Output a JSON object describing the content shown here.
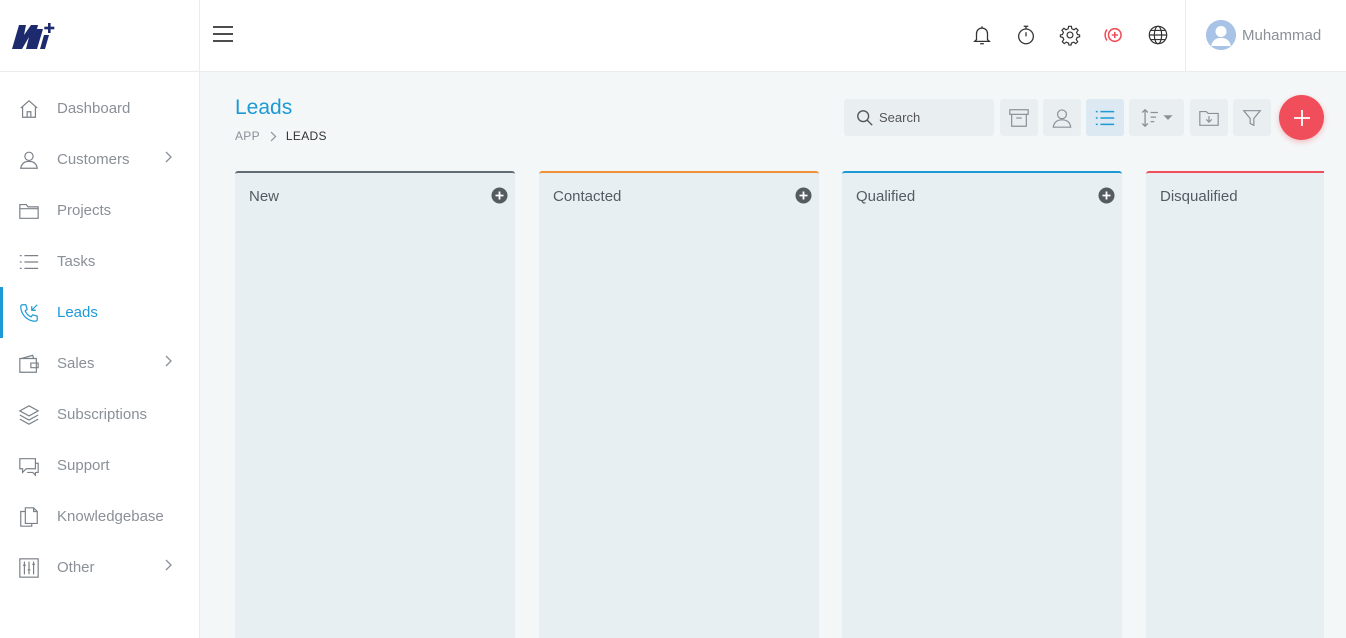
{
  "brand": {
    "logo_icon": "m-plus-logo",
    "accent": "#1d9ad6",
    "danger": "#f04e5a"
  },
  "sidebar": {
    "items": [
      {
        "label": "Dashboard",
        "icon": "home-icon",
        "has_children": false,
        "active": false
      },
      {
        "label": "Customers",
        "icon": "user-icon",
        "has_children": true,
        "active": false
      },
      {
        "label": "Projects",
        "icon": "folder-icon",
        "has_children": false,
        "active": false
      },
      {
        "label": "Tasks",
        "icon": "list-icon",
        "has_children": false,
        "active": false
      },
      {
        "label": "Leads",
        "icon": "phone-incoming-icon",
        "has_children": false,
        "active": true
      },
      {
        "label": "Sales",
        "icon": "wallet-icon",
        "has_children": true,
        "active": false
      },
      {
        "label": "Subscriptions",
        "icon": "layers-icon",
        "has_children": false,
        "active": false
      },
      {
        "label": "Support",
        "icon": "chat-icon",
        "has_children": false,
        "active": false
      },
      {
        "label": "Knowledgebase",
        "icon": "documents-icon",
        "has_children": false,
        "active": false
      },
      {
        "label": "Other",
        "icon": "sliders-icon",
        "has_children": true,
        "active": false
      }
    ]
  },
  "topbar": {
    "icons": [
      "menu-icon",
      "bell-icon",
      "timer-icon",
      "gear-icon",
      "help-plus-icon",
      "globe-icon"
    ],
    "user": {
      "name": "Muhammad",
      "avatar": "avatar-icon"
    }
  },
  "page": {
    "title": "Leads",
    "breadcrumb": {
      "root": "APP",
      "current": "LEADS"
    }
  },
  "toolbar": {
    "search_placeholder": "Search",
    "buttons": [
      "archive-icon",
      "user-icon",
      "list-view-icon",
      "sort-icon",
      "download-folder-icon",
      "filter-icon"
    ],
    "active_button": "list-view-icon",
    "add_button": "plus-icon"
  },
  "board": {
    "columns": [
      {
        "title": "New",
        "color": "#5f6b75",
        "has_add": true
      },
      {
        "title": "Contacted",
        "color": "#f0913a",
        "has_add": true
      },
      {
        "title": "Qualified",
        "color": "#1d9ad6",
        "has_add": true
      },
      {
        "title": "Disqualified",
        "color": "#f04e5a",
        "has_add": false
      }
    ]
  }
}
